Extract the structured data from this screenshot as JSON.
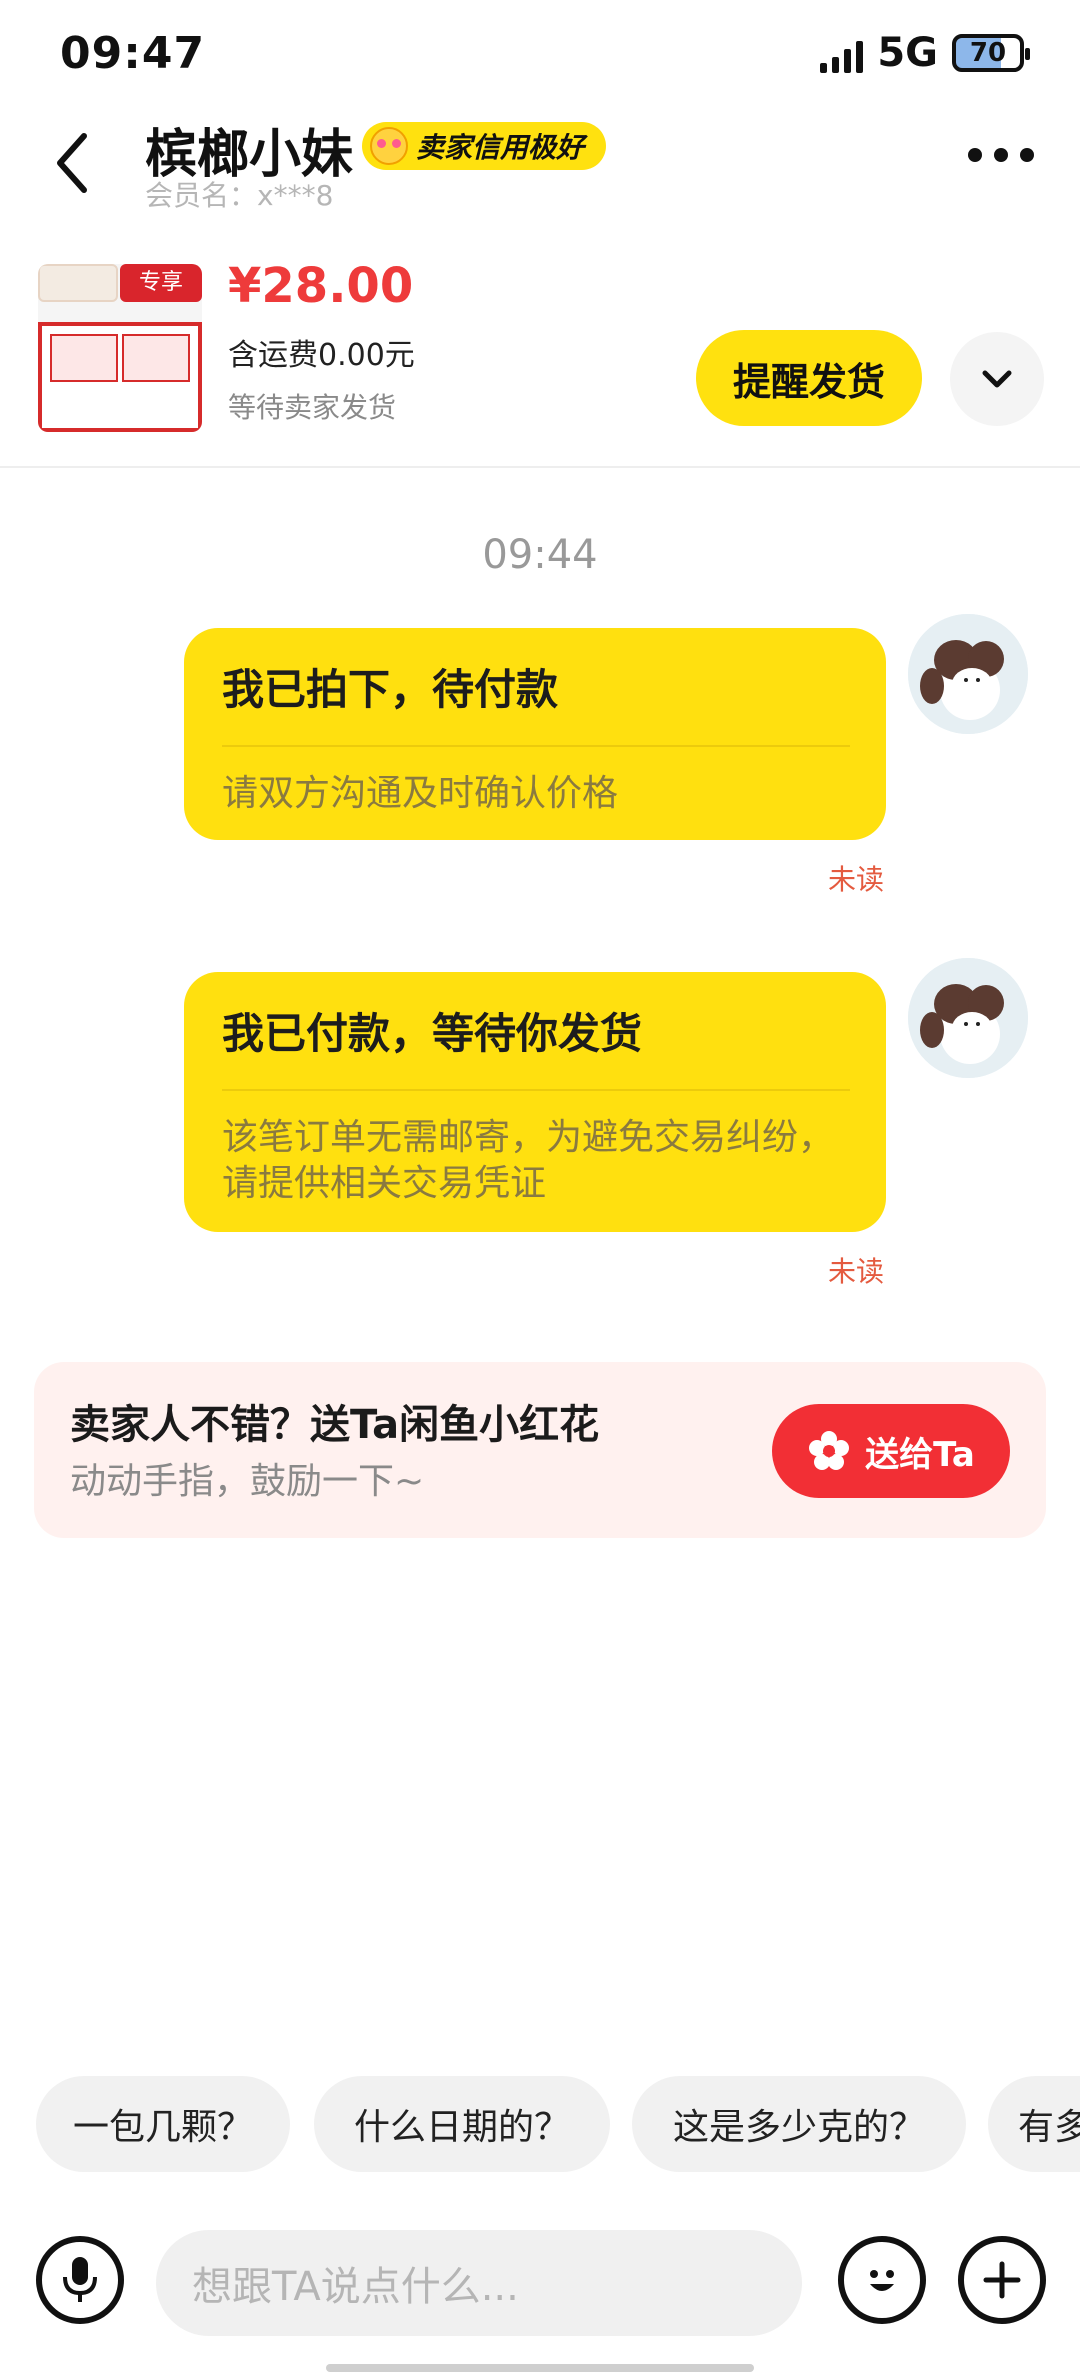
{
  "status_bar": {
    "time": "09:47",
    "network": "5G",
    "battery": "70"
  },
  "header": {
    "title": "槟榔小妹",
    "badge": "卖家信用极好",
    "member": "会员名：x***8"
  },
  "order": {
    "thumb_tag": "专享",
    "price": "¥28.00",
    "shipping": "含运费0.00元",
    "status": "等待卖家发货",
    "remind_button": "提醒发货"
  },
  "chat": {
    "time": "09:44",
    "messages": [
      {
        "title": "我已拍下，待付款",
        "subtitle": "请双方沟通及时确认价格",
        "status": "未读"
      },
      {
        "title": "我已付款，等待你发货",
        "subtitle": "该笔订单无需邮寄，为避免交易纠纷，请提供相关交易凭证",
        "status": "未读"
      }
    ]
  },
  "flower_card": {
    "title": "卖家人不错？送Ta闲鱼小红花",
    "subtitle": "动动手指，鼓励一下~",
    "button": "送给Ta"
  },
  "suggestions": [
    "一包几颗？",
    "什么日期的？",
    "这是多少克的？",
    "有多"
  ],
  "input": {
    "placeholder": "想跟TA说点什么..."
  },
  "colors": {
    "accent_yellow": "#ffe10f",
    "price_red": "#ee3b3b",
    "send_red": "#f22f35"
  },
  "icons": [
    "back-icon",
    "more-icon",
    "chevron-down-icon",
    "microphone-icon",
    "emoji-icon",
    "plus-icon",
    "flower-icon",
    "avatar-icon"
  ]
}
